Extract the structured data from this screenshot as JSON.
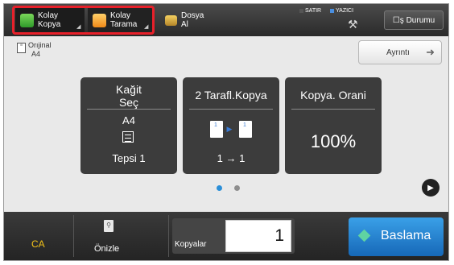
{
  "modes": {
    "kopya": {
      "line1": "Kolay",
      "line2": "Kopya"
    },
    "tarama": {
      "line1": "Kolay",
      "line2": "Tarama"
    },
    "dosya": {
      "line1": "Dosya",
      "line2": "Al"
    }
  },
  "status": {
    "satir": "SATIR",
    "yazici": "YAZICI"
  },
  "is_durumu": "☐ş Durumu",
  "original": {
    "label": "Orıjinal",
    "size": "A4"
  },
  "details_label": "Ayrıntı",
  "tiles": {
    "paper": {
      "title_line1": "Kağit",
      "title_line2": "Seç",
      "size": "A4",
      "tray": "Tepsi 1"
    },
    "duplex": {
      "title": "2 Tarafl.Kopya",
      "page_left": "1",
      "page_right": "1",
      "value": "1 → 1"
    },
    "ratio": {
      "title": "Kopya. Orani",
      "value": "100%"
    }
  },
  "pager": {
    "pages": 2,
    "active": 1
  },
  "bottom": {
    "ca_label": "CA",
    "preview_label": "Önizle",
    "copies_label": "Kopyalar",
    "copies_value": "1",
    "start_label": "Baslama"
  },
  "colors": {
    "highlight": "#e8202a",
    "start_button": "#2a86d4",
    "ca_text": "#f2c21a",
    "active_dot": "#2b8fd8"
  }
}
